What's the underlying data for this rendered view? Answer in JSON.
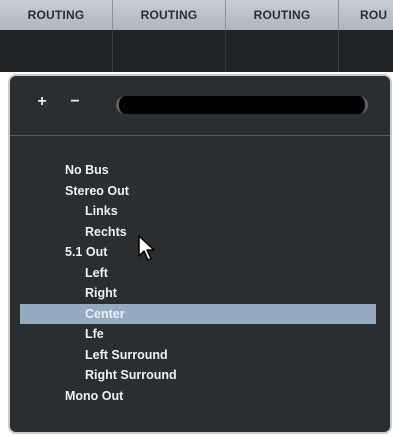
{
  "header": {
    "columns": [
      "ROUTING",
      "ROUTING",
      "ROUTING",
      "ROU"
    ]
  },
  "toolbar": {
    "add_label": "+",
    "remove_label": "−",
    "search": {
      "value": "",
      "placeholder": ""
    }
  },
  "bus_list": {
    "items": [
      {
        "label": "No Bus",
        "level": 0,
        "selected": false
      },
      {
        "label": "Stereo Out",
        "level": 0,
        "selected": false
      },
      {
        "label": "Links",
        "level": 1,
        "selected": false
      },
      {
        "label": "Rechts",
        "level": 1,
        "selected": false
      },
      {
        "label": "5.1 Out",
        "level": 0,
        "selected": false
      },
      {
        "label": "Left",
        "level": 1,
        "selected": false
      },
      {
        "label": "Right",
        "level": 1,
        "selected": false
      },
      {
        "label": "Center",
        "level": 1,
        "selected": true
      },
      {
        "label": "Lfe",
        "level": 1,
        "selected": false
      },
      {
        "label": "Left Surround",
        "level": 1,
        "selected": false
      },
      {
        "label": "Right Surround",
        "level": 1,
        "selected": false
      },
      {
        "label": "Mono Out",
        "level": 0,
        "selected": false
      }
    ]
  },
  "colors": {
    "panel_bg": "#2b2e31",
    "selection": "#93acc2",
    "header_bg": "#b9c1c7"
  },
  "cursor_icon": "mouse-pointer-icon"
}
